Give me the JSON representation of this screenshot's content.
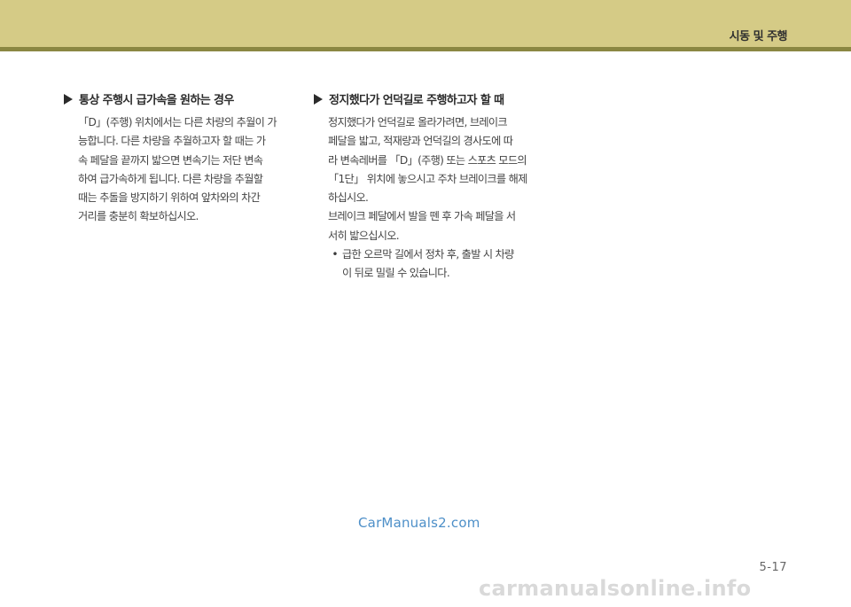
{
  "header": {
    "section_title": "시동 및 주행",
    "band_color": "#d5cb86",
    "rule_color": "#8b8742"
  },
  "left": {
    "heading": "통상 주행시 급가속을 원하는 경우",
    "body": "「D」(주행) 위치에서는 다른 차량의 추월이 가\n능합니다. 다른 차량을 추월하고자 할 때는 가\n속 페달을 끝까지 밟으면 변속기는 저단 변속\n하여 급가속하게 됩니다. 다른 차량을 추월할\n때는 추돌을 방지하기 위하여 앞차와의 차간\n거리를 충분히 확보하십시오."
  },
  "right": {
    "heading": "정지했다가 언덕길로 주행하고자 할 때",
    "body1": "정지했다가 언덕길로 올라가려면, 브레이크\n페달을 밟고, 적재량과 언덕길의 경사도에 따\n라 변속레버를 「D」(주행) 또는 스포츠 모드의\n「1단」 위치에 놓으시고 주차 브레이크를 해제\n하십시오.",
    "body2": "브레이크 페달에서 발을 뗀 후 가속 페달을 서\n서히 밟으십시오.",
    "bullet": "급한 오르막 길에서 정차 후, 출발 시 차량\n이 뒤로 밀릴 수 있습니다."
  },
  "watermark": "CarManuals2.com",
  "page_number": "5-17",
  "footer_watermark": "carmanualsonline.info"
}
